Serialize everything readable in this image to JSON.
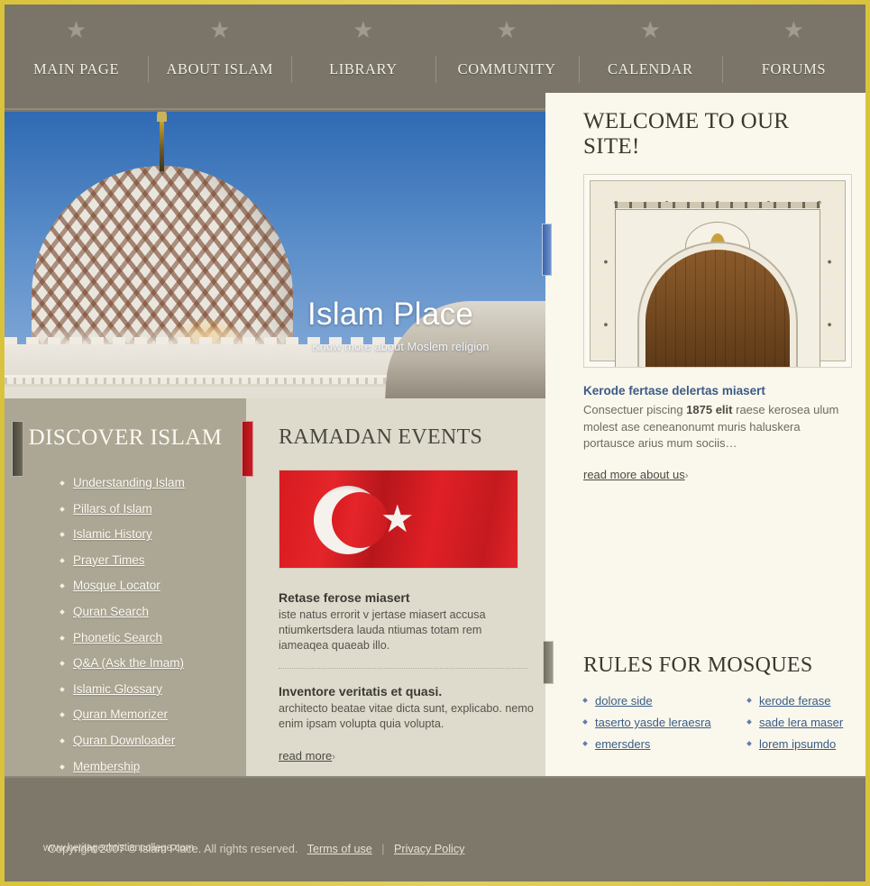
{
  "site": {
    "title": "Islam Place",
    "tagline": "Know more about Moslem religion"
  },
  "nav": {
    "items": [
      {
        "label": "MAIN PAGE"
      },
      {
        "label": "ABOUT ISLAM"
      },
      {
        "label": "LIBRARY"
      },
      {
        "label": "COMMUNITY"
      },
      {
        "label": "CALENDAR"
      },
      {
        "label": "FORUMS"
      }
    ],
    "star_glyph": "★"
  },
  "hero_icons": [
    {
      "name": "home-icon"
    },
    {
      "name": "mail-icon"
    },
    {
      "name": "sitemap-icon"
    }
  ],
  "sidebar": {
    "heading": "DISCOVER ISLAM",
    "items": [
      {
        "label": "Understanding Islam"
      },
      {
        "label": "Pillars of Islam"
      },
      {
        "label": "Islamic History"
      },
      {
        "label": "Prayer Times"
      },
      {
        "label": "Mosque Locator"
      },
      {
        "label": "Quran Search"
      },
      {
        "label": "Phonetic Search"
      },
      {
        "label": "Q&A (Ask the Imam)"
      },
      {
        "label": "Islamic Glossary"
      },
      {
        "label": "Quran Memorizer"
      },
      {
        "label": "Quran Downloader"
      },
      {
        "label": "Membership"
      }
    ]
  },
  "center": {
    "heading": "RAMADAN EVENTS",
    "flag_alt": "turkish-flag",
    "entries": [
      {
        "title": "Retase ferose miasert",
        "body": "iste natus errorit v jertase miasert accusa ntiumkertsdera lauda ntiumas totam rem iameaqea quaeab illo."
      },
      {
        "title": "Inventore veritatis et quasi.",
        "body": "architecto beatae vitae dicta sunt, explicabo. nemo enim ipsam volupta quia volupta."
      }
    ],
    "read_more": "read more",
    "arrow": "›"
  },
  "welcome": {
    "heading": "WELCOME TO OUR SITE!",
    "image_alt": "mosque-doorway",
    "article_title": "Kerode fertase delertas miasert",
    "article_body_pre": "Consectuer piscing ",
    "article_body_bold": "1875 elit",
    "article_body_post": " raese kerosea ulum molest ase ceneanonumt muris haluskera portausce arius mum sociis…",
    "read_more": "read more about us",
    "arrow": "›"
  },
  "rules": {
    "heading": "RULES FOR MOSQUES",
    "items": [
      {
        "label": "dolore side"
      },
      {
        "label": "kerode ferase"
      },
      {
        "label": "taserto yasde leraesra"
      },
      {
        "label": "sade lera maser"
      },
      {
        "label": "emersders"
      },
      {
        "label": "lorem ipsumdo"
      }
    ]
  },
  "footer": {
    "copyright": "Copyright 2007 © Islam Place. All rights reserved.",
    "terms": "Terms of use",
    "separator": "|",
    "privacy": "Privacy Policy",
    "watermark": "www.heritagechristiancollege.com"
  },
  "colors": {
    "gold_border": "#d9c33c",
    "nav_bg": "#7a7568",
    "sidebar_bg": "#aca694",
    "center_bg": "#dedbcd",
    "right_bg": "#faf7ec",
    "link_blue": "#3b5b86",
    "accent_red": "#cf1b21"
  }
}
